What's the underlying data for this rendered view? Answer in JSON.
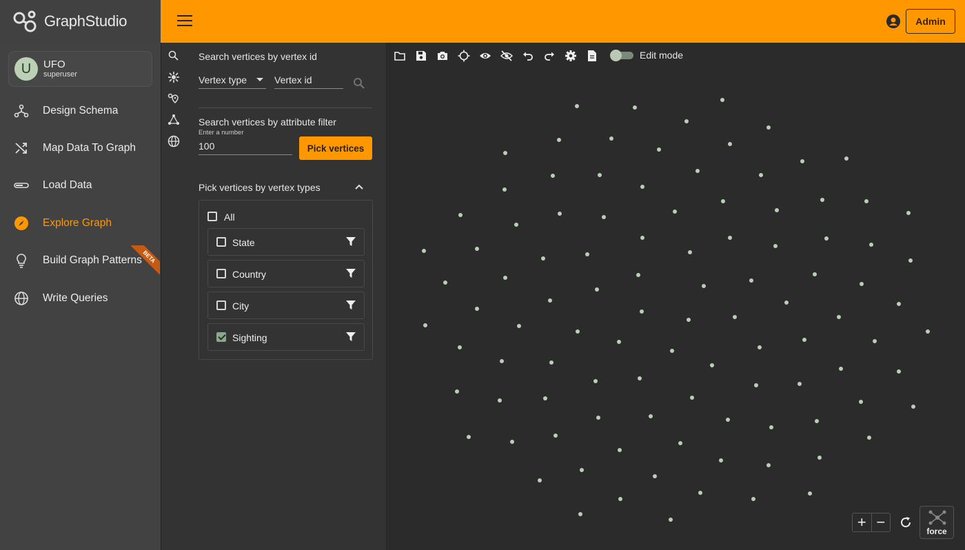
{
  "app": {
    "logo_text_graph": "Graph",
    "logo_text_studio": "Studio"
  },
  "header": {
    "admin_label": "Admin"
  },
  "profile": {
    "initial": "U",
    "name": "UFO",
    "role": "superuser"
  },
  "nav": {
    "items": [
      {
        "label": "Design Schema",
        "icon": "schema-icon"
      },
      {
        "label": "Map Data To Graph",
        "icon": "shuffle-icon"
      },
      {
        "label": "Load Data",
        "icon": "load-icon"
      },
      {
        "label": "Explore Graph",
        "icon": "compass-icon",
        "active": true
      },
      {
        "label": "Build Graph Patterns",
        "icon": "lightbulb-icon",
        "badge": "BETA"
      },
      {
        "label": "Write Queries",
        "icon": "globe-icon"
      }
    ]
  },
  "panel": {
    "search_by_id_title": "Search vertices by vertex id",
    "vertex_type_placeholder": "Vertex type",
    "vertex_id_placeholder": "Vertex id",
    "attr_filter_title": "Search vertices by attribute filter",
    "number_label": "Enter a number",
    "number_value": "100",
    "pick_button": "Pick vertices",
    "pick_types_title": "Pick vertices by vertex types",
    "all_label": "All",
    "all_checked": false,
    "types": [
      {
        "label": "State",
        "checked": false
      },
      {
        "label": "Country",
        "checked": false
      },
      {
        "label": "City",
        "checked": false
      },
      {
        "label": "Sighting",
        "checked": true
      }
    ]
  },
  "canvas": {
    "edit_mode_label": "Edit mode",
    "edit_mode_on": false,
    "force_label": "force",
    "vertex_count": 103
  },
  "colors": {
    "accent": "#ff9800",
    "vertex": "#b8d0b4",
    "sidebar": "#424242",
    "canvas": "#2b2b2b"
  }
}
